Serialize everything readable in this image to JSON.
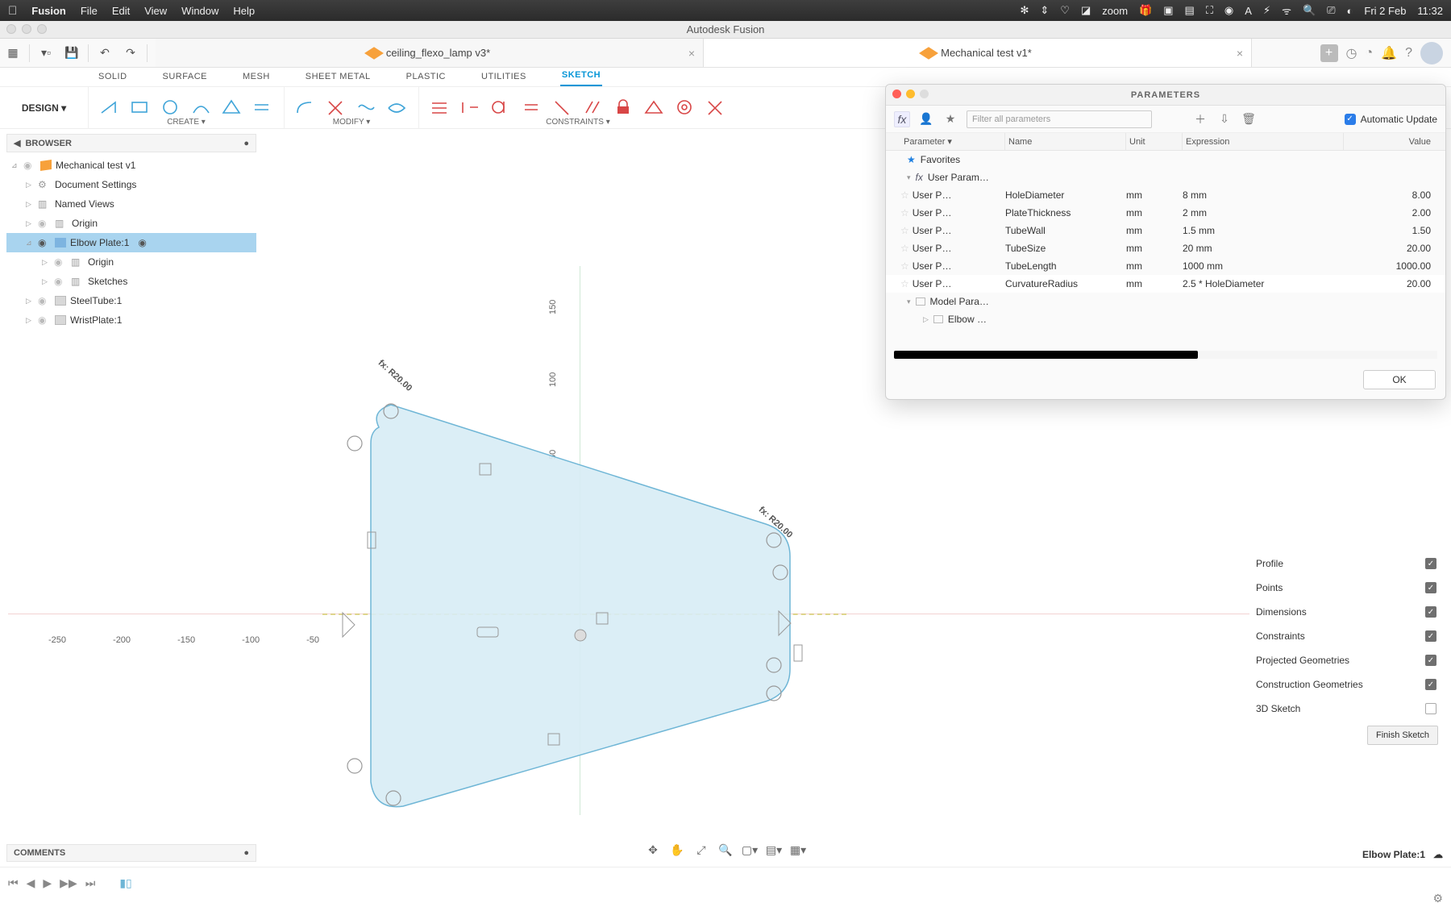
{
  "menubar": {
    "app": "Fusion",
    "items": [
      "File",
      "Edit",
      "View",
      "Window",
      "Help"
    ],
    "right_app": "zoom",
    "date": "Fri 2 Feb",
    "time": "11:32"
  },
  "window": {
    "title": "Autodesk Fusion"
  },
  "tabs": [
    {
      "label": "ceiling_flexo_lamp v3*",
      "active": false
    },
    {
      "label": "Mechanical test v1*",
      "active": true
    }
  ],
  "design_label": "DESIGN ▾",
  "tool_tabs": [
    "SOLID",
    "SURFACE",
    "MESH",
    "SHEET METAL",
    "PLASTIC",
    "UTILITIES",
    "SKETCH"
  ],
  "tool_tab_active": "SKETCH",
  "ribbon_groups": {
    "create": "CREATE ▾",
    "modify": "MODIFY ▾",
    "constraints": "CONSTRAINTS ▾"
  },
  "browser": {
    "title": "BROWSER",
    "root": "Mechanical test v1",
    "items": [
      {
        "label": "Document Settings",
        "icon": "gear"
      },
      {
        "label": "Named Views",
        "icon": "folder"
      },
      {
        "label": "Origin",
        "icon": "folder"
      },
      {
        "label": "Elbow Plate:1",
        "icon": "component",
        "selected": true,
        "expanded": true
      },
      {
        "label": "Origin",
        "icon": "folder",
        "indent": 2
      },
      {
        "label": "Sketches",
        "icon": "folder",
        "indent": 2
      },
      {
        "label": "SteelTube:1",
        "icon": "component"
      },
      {
        "label": "WristPlate:1",
        "icon": "component"
      }
    ]
  },
  "comments_label": "COMMENTS",
  "ruler_x": [
    "150",
    "100",
    "50"
  ],
  "ruler_y": [
    "-250",
    "-200",
    "-150",
    "-100",
    "-50"
  ],
  "dims": {
    "r1": "R20.00",
    "r1p": "fx:",
    "r2": "R20.00",
    "r2p": "fx:"
  },
  "parameters": {
    "title": "PARAMETERS",
    "filter_placeholder": "Filter all parameters",
    "auto_update_label": "Automatic Update",
    "head": [
      "Parameter",
      "Name",
      "Unit",
      "Expression",
      "Value"
    ],
    "favorites_label": "Favorites",
    "user_param_label": "User Param…",
    "model_param_label": "Model Para…",
    "elbow_label": "Elbow …",
    "param_col": "User P…",
    "rows": [
      {
        "name": "HoleDiameter",
        "unit": "mm",
        "expr": "8 mm",
        "value": "8.00"
      },
      {
        "name": "PlateThickness",
        "unit": "mm",
        "expr": "2 mm",
        "value": "2.00"
      },
      {
        "name": "TubeWall",
        "unit": "mm",
        "expr": "1.5 mm",
        "value": "1.50"
      },
      {
        "name": "TubeSize",
        "unit": "mm",
        "expr": "20 mm",
        "value": "20.00"
      },
      {
        "name": "TubeLength",
        "unit": "mm",
        "expr": "1000 mm",
        "value": "1000.00"
      },
      {
        "name": "CurvatureRadius",
        "unit": "mm",
        "expr": "2.5 * HoleDiameter",
        "value": "20.00"
      }
    ],
    "ok": "OK"
  },
  "sketch_palette": {
    "items": [
      {
        "label": "Profile",
        "checked": true
      },
      {
        "label": "Points",
        "checked": true
      },
      {
        "label": "Dimensions",
        "checked": true
      },
      {
        "label": "Constraints",
        "checked": true
      },
      {
        "label": "Projected Geometries",
        "checked": true
      },
      {
        "label": "Construction Geometries",
        "checked": true
      },
      {
        "label": "3D Sketch",
        "checked": false
      }
    ],
    "finish": "Finish Sketch"
  },
  "status_right": "Elbow Plate:1"
}
